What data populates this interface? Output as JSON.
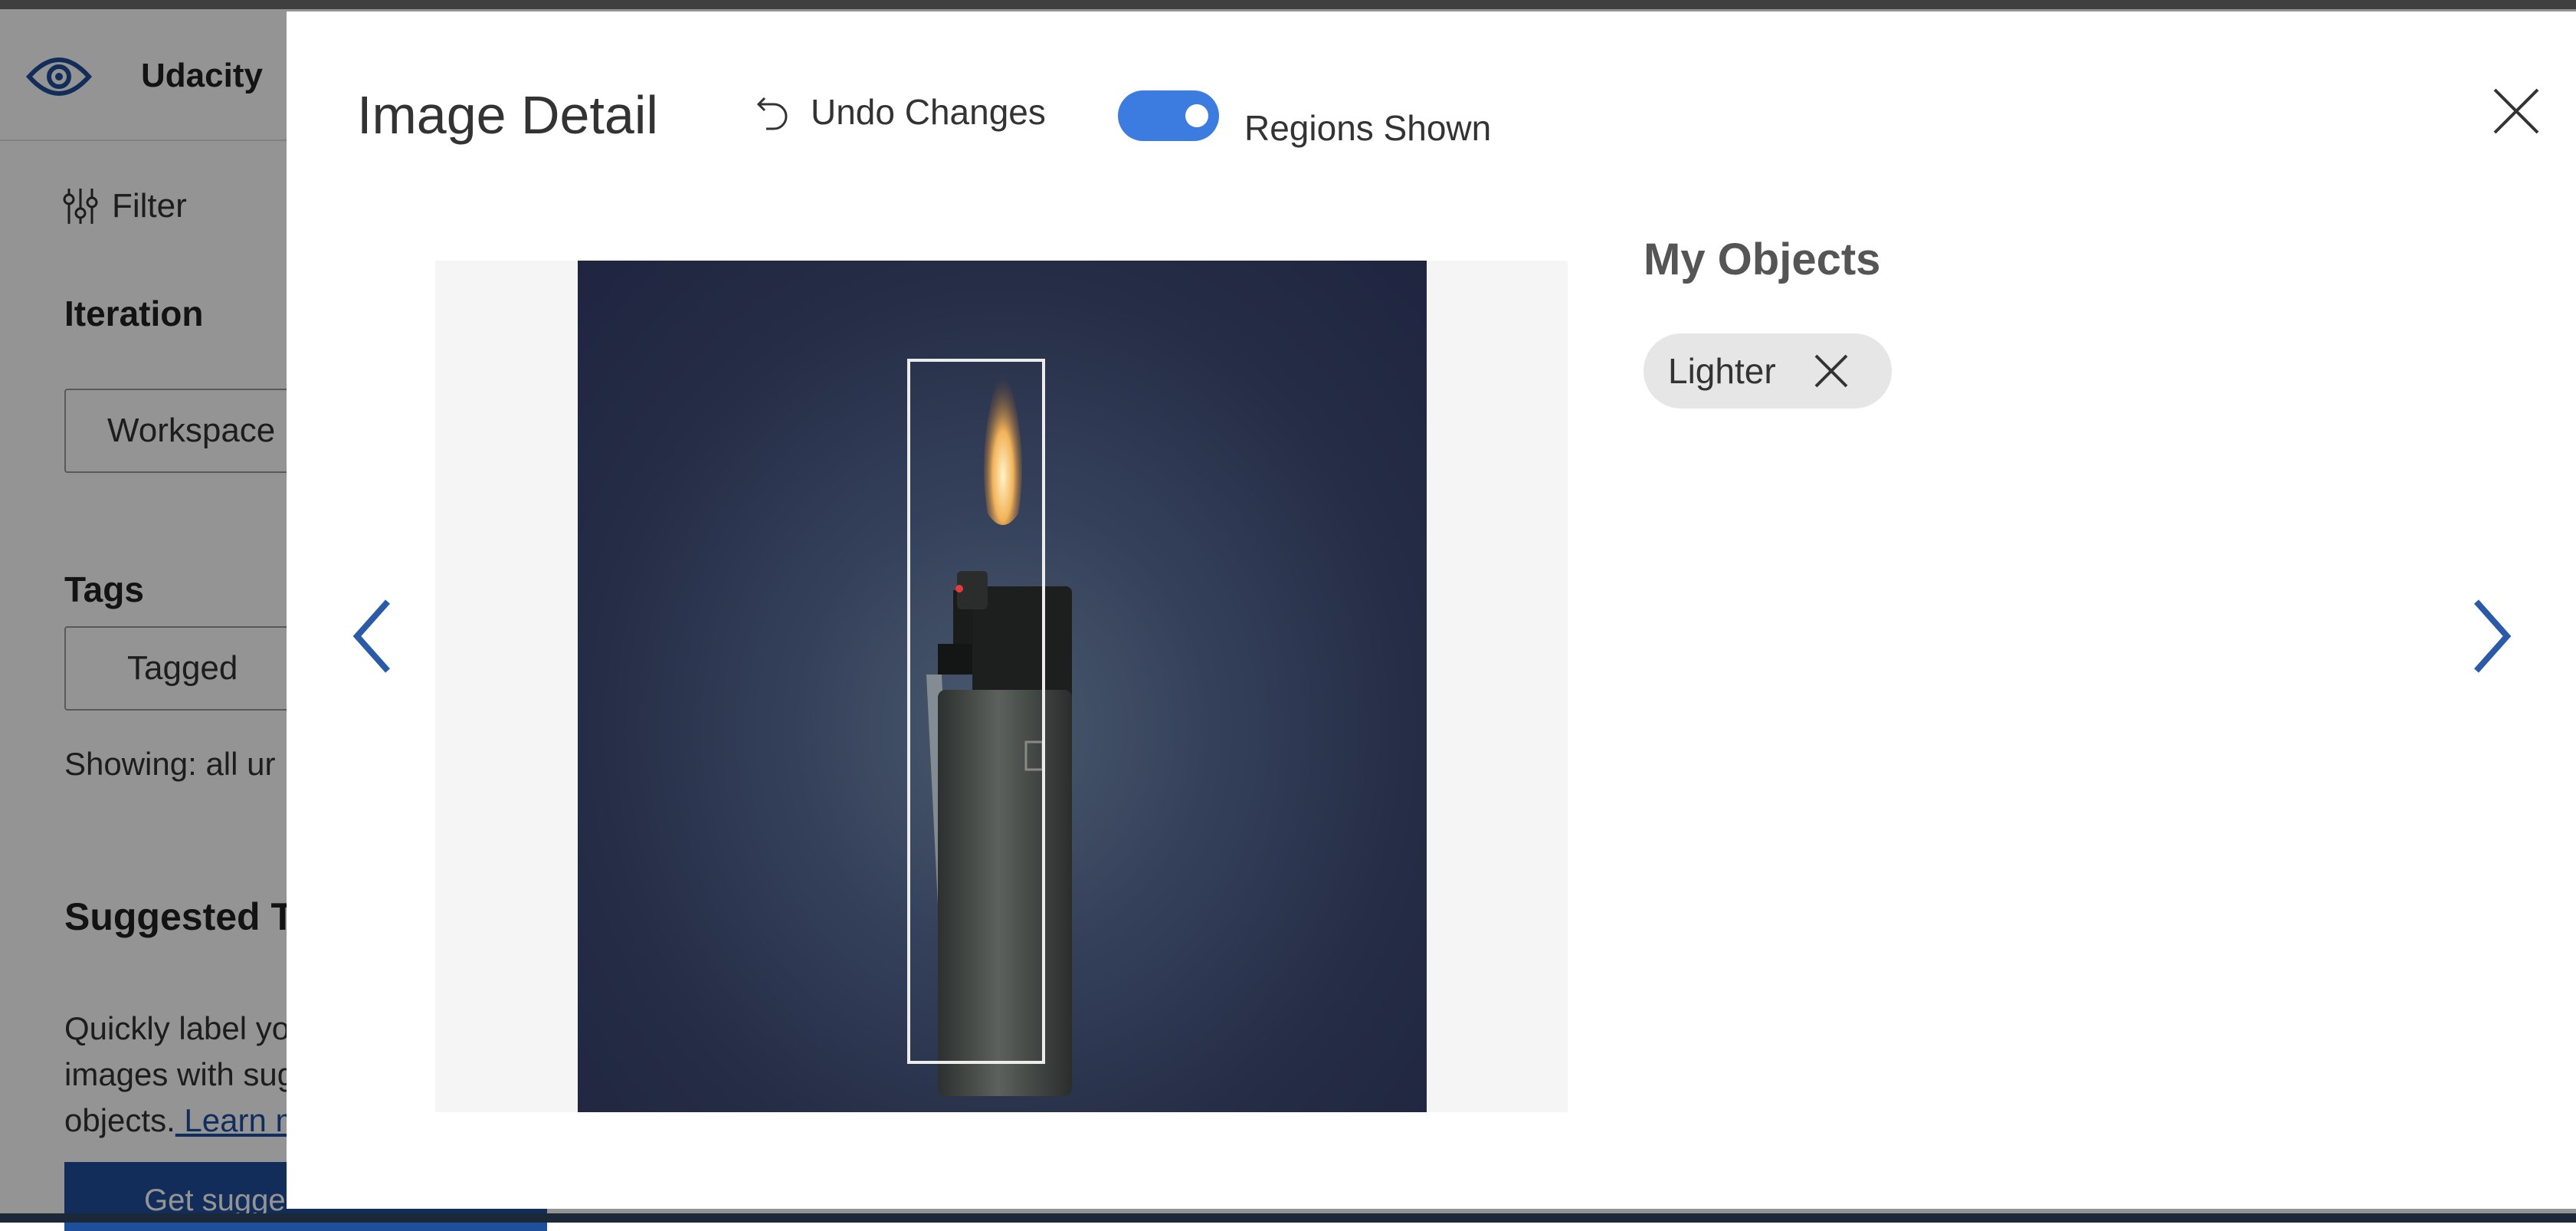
{
  "app": {
    "title": "Udacity",
    "filter_label": "Filter",
    "iteration_heading": "Iteration",
    "iteration_value": "Workspace",
    "tags_heading": "Tags",
    "tags_value": "Tagged",
    "showing_text": "Showing: all ur",
    "suggested_heading": "Suggested T",
    "suggested_desc_1": "Quickly label yo",
    "suggested_desc_2": "images with sug",
    "suggested_desc_3": "objects.",
    "learn_more": " Learn m",
    "suggest_button": "Get sugge"
  },
  "modal": {
    "title": "Image Detail",
    "undo_label": "Undo Changes",
    "toggle_label": "Regions Shown",
    "toggle_on": true,
    "objects_title": "My Objects",
    "tags": [
      {
        "label": "Lighter"
      }
    ]
  },
  "colors": {
    "accent": "#3c7be0",
    "nav_arrow": "#2b5ba8",
    "photo_bg": "#252c45"
  }
}
